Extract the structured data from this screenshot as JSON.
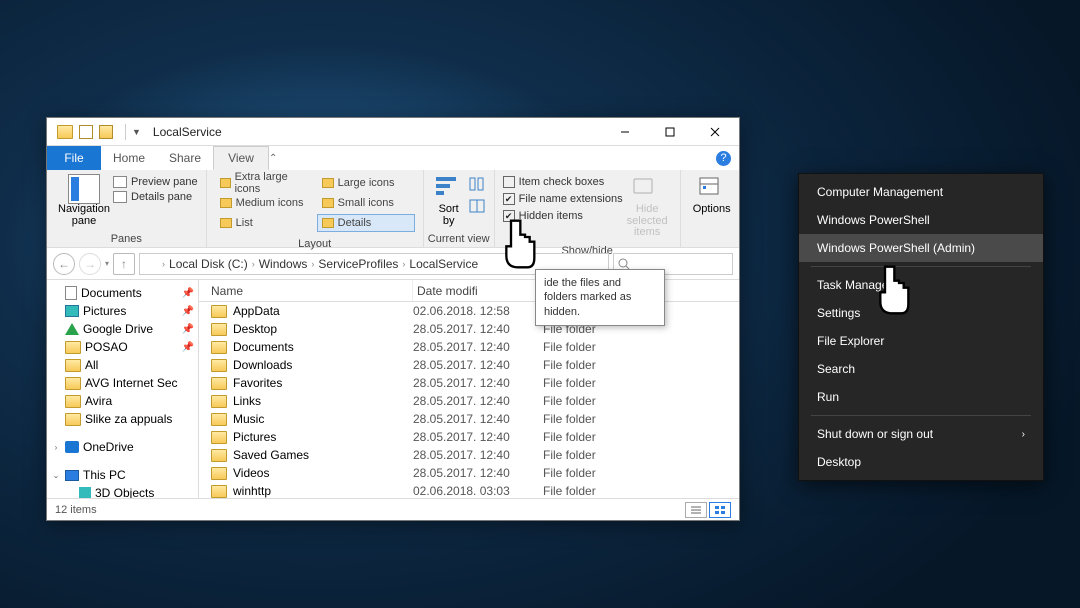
{
  "title": "LocalService",
  "tabs": {
    "file": "File",
    "home": "Home",
    "share": "Share",
    "view": "View"
  },
  "ribbon": {
    "panes": {
      "label": "Panes",
      "navigation": "Navigation\npane",
      "preview": "Preview pane",
      "details": "Details pane"
    },
    "layout": {
      "label": "Layout",
      "opts": [
        "Extra large icons",
        "Large icons",
        "Medium icons",
        "Small icons",
        "List",
        "Details"
      ],
      "selected": "Details"
    },
    "current": {
      "label": "Current view",
      "sort": "Sort\nby"
    },
    "showhide": {
      "label": "Show/hide",
      "boxes": "Item check boxes",
      "ext": "File name extensions",
      "hidden": "Hidden items",
      "hidebtn": "Hide selected\nitems"
    },
    "options": "Options"
  },
  "breadcrumb": [
    "Local Disk (C:)",
    "Windows",
    "ServiceProfiles",
    "LocalService"
  ],
  "cols": {
    "name": "Name",
    "date": "Date modifi",
    "type": ""
  },
  "files": [
    {
      "n": "AppData",
      "d": "02.06.2018. 12:58",
      "t": "File folder"
    },
    {
      "n": "Desktop",
      "d": "28.05.2017. 12:40",
      "t": "File folder"
    },
    {
      "n": "Documents",
      "d": "28.05.2017. 12:40",
      "t": "File folder"
    },
    {
      "n": "Downloads",
      "d": "28.05.2017. 12:40",
      "t": "File folder"
    },
    {
      "n": "Favorites",
      "d": "28.05.2017. 12:40",
      "t": "File folder"
    },
    {
      "n": "Links",
      "d": "28.05.2017. 12:40",
      "t": "File folder"
    },
    {
      "n": "Music",
      "d": "28.05.2017. 12:40",
      "t": "File folder"
    },
    {
      "n": "Pictures",
      "d": "28.05.2017. 12:40",
      "t": "File folder"
    },
    {
      "n": "Saved Games",
      "d": "28.05.2017. 12:40",
      "t": "File folder"
    },
    {
      "n": "Videos",
      "d": "28.05.2017. 12:40",
      "t": "File folder"
    },
    {
      "n": "winhttp",
      "d": "02.06.2018. 03:03",
      "t": "File folder"
    }
  ],
  "sidebar_quick": [
    {
      "label": "Documents",
      "pin": true,
      "icon": "doc"
    },
    {
      "label": "Pictures",
      "pin": true,
      "icon": "pic"
    },
    {
      "label": "Google Drive",
      "pin": true,
      "icon": "gdrive"
    },
    {
      "label": "POSAO",
      "pin": true,
      "icon": "folder"
    },
    {
      "label": "All",
      "pin": false,
      "icon": "folder"
    },
    {
      "label": "AVG Internet Sec",
      "pin": false,
      "icon": "folder"
    },
    {
      "label": "Avira",
      "pin": false,
      "icon": "folder"
    },
    {
      "label": "Slike za appuals",
      "pin": false,
      "icon": "folder"
    }
  ],
  "sidebar_onedrive": "OneDrive",
  "sidebar_thispc": "This PC",
  "sidebar_3d": "3D Objects",
  "status": "12 items",
  "tooltip": "ide the files and folders marked as hidden.",
  "winx": {
    "items": [
      "Computer Management",
      "Windows PowerShell",
      "Windows PowerShell (Admin)",
      "Task Manager",
      "Settings",
      "File Explorer",
      "Search",
      "Run",
      "Shut down or sign out",
      "Desktop"
    ],
    "selected_index": 2
  }
}
